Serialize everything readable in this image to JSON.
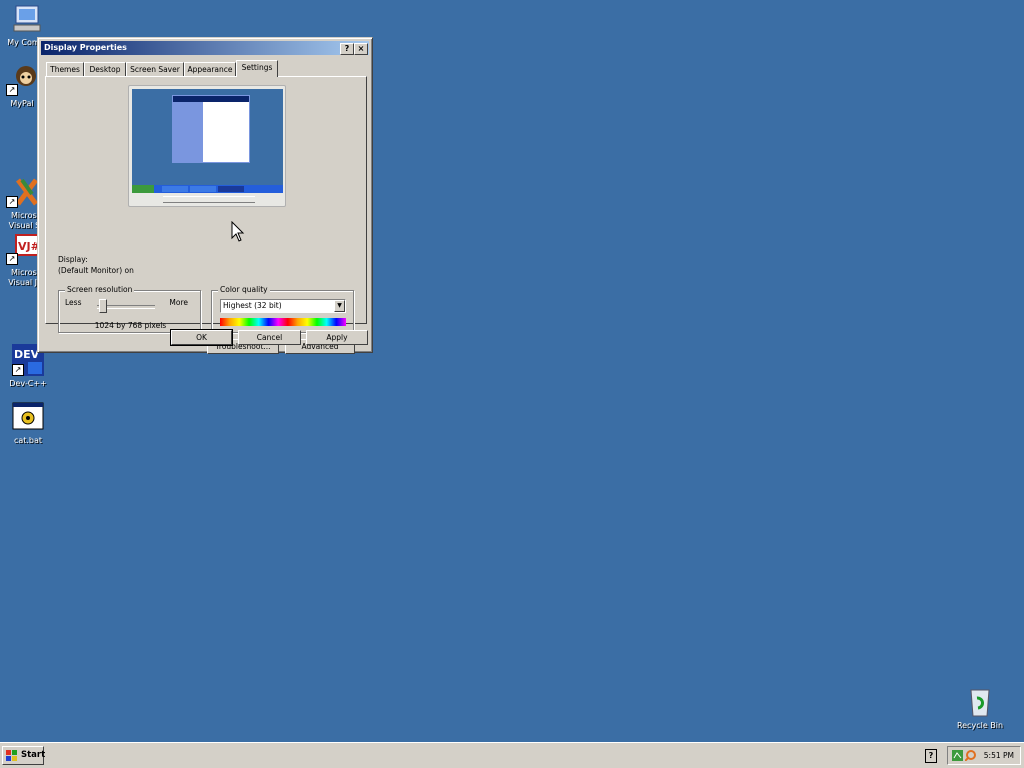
{
  "desktop": {
    "icons": [
      {
        "label": "My Comp",
        "icon": "my-computer-icon"
      },
      {
        "label": "MyPal",
        "icon": "mypal-icon"
      },
      {
        "label": "Microsc Visual St",
        "icon": "visual-studio-icon"
      },
      {
        "label": "Microsc Visual J#",
        "icon": "visual-jsharp-icon"
      },
      {
        "label": "Dev-C++",
        "icon": "dev-cpp-icon"
      },
      {
        "label": "cat.bat",
        "icon": "batch-file-icon"
      },
      {
        "label": "Recycle Bin",
        "icon": "recycle-bin-icon"
      }
    ]
  },
  "dialog": {
    "title": "Display Properties",
    "help_button": "?",
    "close_button": "×",
    "tabs": [
      {
        "label": "Themes"
      },
      {
        "label": "Desktop"
      },
      {
        "label": "Screen Saver"
      },
      {
        "label": "Appearance"
      },
      {
        "label": "Settings",
        "active": true
      }
    ],
    "display_label": "Display:",
    "display_value": "(Default Monitor) on",
    "resolution": {
      "group_label": "Screen resolution",
      "less": "Less",
      "more": "More",
      "value_text": "1024 by 768 pixels"
    },
    "color_quality": {
      "group_label": "Color quality",
      "selected": "Highest (32 bit)"
    },
    "buttons": {
      "troubleshoot": "Troubleshoot...",
      "advanced": "Advanced",
      "ok": "OK",
      "cancel": "Cancel",
      "apply": "Apply"
    }
  },
  "taskbar": {
    "start_label": "Start",
    "clock": "5:51 PM"
  }
}
